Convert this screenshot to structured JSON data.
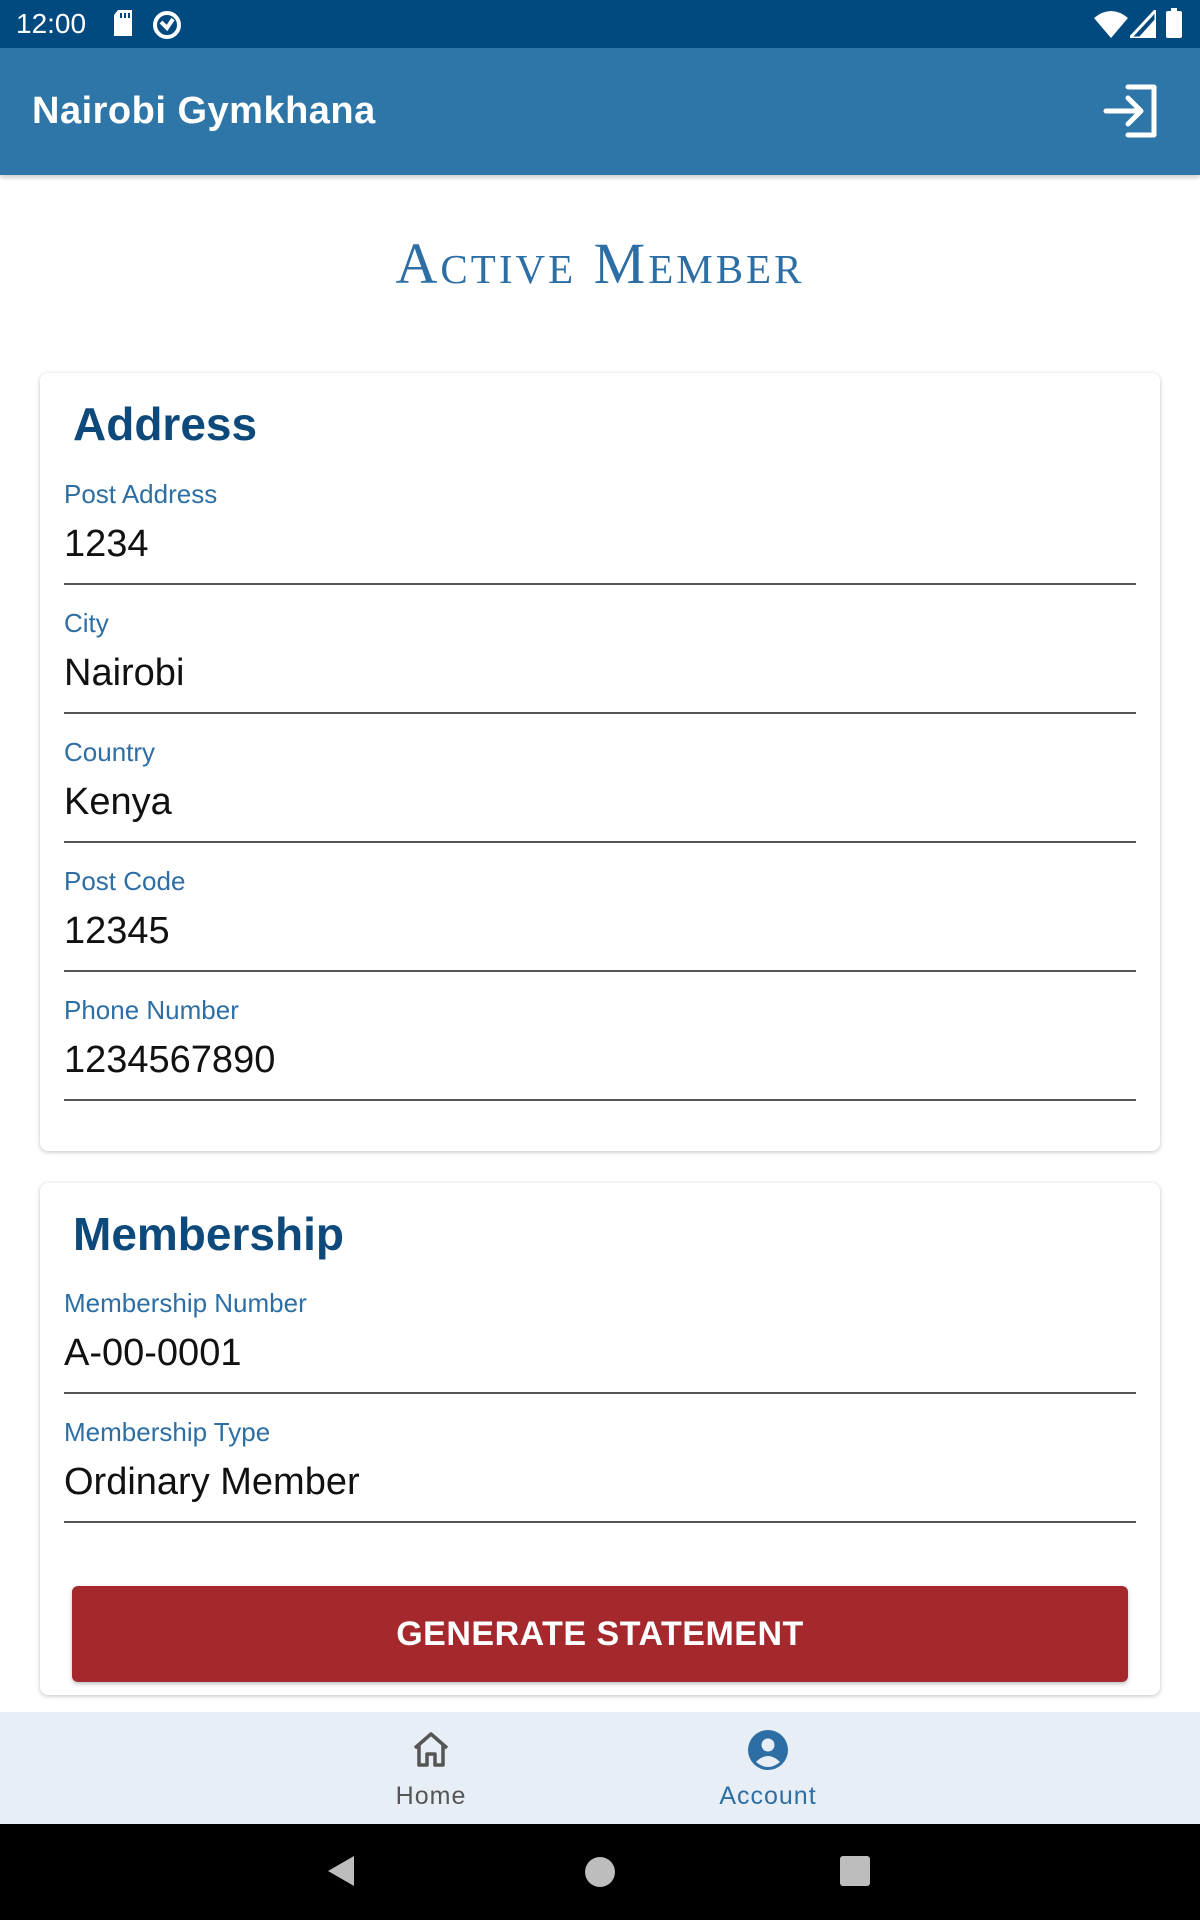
{
  "status_bar": {
    "time": "12:00"
  },
  "app_bar": {
    "title": "Nairobi Gymkhana"
  },
  "page": {
    "title": "Active Member"
  },
  "address": {
    "heading": "Address",
    "fields": [
      {
        "label": "Post Address",
        "value": "1234"
      },
      {
        "label": "City",
        "value": "Nairobi"
      },
      {
        "label": "Country",
        "value": "Kenya"
      },
      {
        "label": "Post Code",
        "value": "12345"
      },
      {
        "label": "Phone Number",
        "value": "1234567890"
      }
    ]
  },
  "membership": {
    "heading": "Membership",
    "fields": [
      {
        "label": "Membership Number",
        "value": "A-00-0001"
      },
      {
        "label": "Membership Type",
        "value": "Ordinary Member"
      }
    ]
  },
  "actions": {
    "generate_statement": "GENERATE STATEMENT"
  },
  "bottom_nav": {
    "items": [
      {
        "label": "Home",
        "icon": "home-icon",
        "active": false
      },
      {
        "label": "Account",
        "icon": "account-circle-icon",
        "active": true
      }
    ],
    "active_color": "#2d6ea4",
    "inactive_color": "#555555"
  },
  "colors": {
    "status_bar": "#014a7f",
    "app_bar": "#2e75a8",
    "heading": "#0d4a7b",
    "label": "#2d6ea4",
    "button": "#a5282c"
  }
}
